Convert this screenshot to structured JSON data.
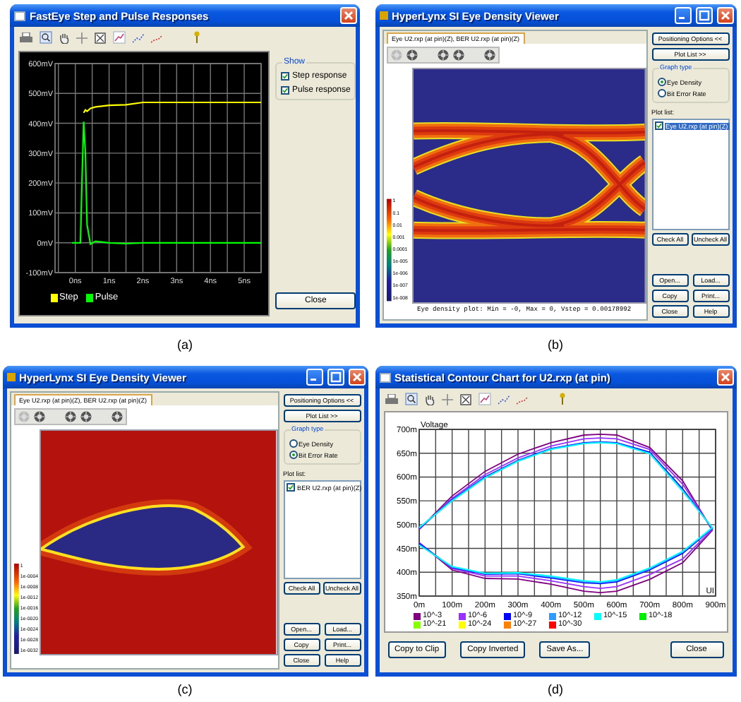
{
  "panels": [
    {
      "kind": "step_response",
      "window": {
        "title": "FastEye Step and Pulse Responses"
      },
      "chart": {
        "chart_data": {
          "type": "line",
          "x": [
            -0.1,
            0.15,
            0.2,
            0.25,
            0.3,
            0.35,
            0.45,
            0.6,
            1,
            1.5,
            2,
            2.5,
            3,
            4,
            5.5
          ],
          "xlim": [
            -0.6,
            5.5
          ],
          "ylim": [
            -100,
            600
          ],
          "xticks": [
            {
              "value": 0,
              "label": "0ns"
            },
            {
              "value": 1,
              "label": "1ns"
            },
            {
              "value": 2,
              "label": "2ns"
            },
            {
              "value": 3,
              "label": "3ns"
            },
            {
              "value": 4,
              "label": "4ns"
            },
            {
              "value": 5,
              "label": "5ns"
            }
          ],
          "yticks": [
            {
              "value": 600,
              "label": "600mV"
            },
            {
              "value": 500,
              "label": "500mV"
            },
            {
              "value": 400,
              "label": "400mV"
            },
            {
              "value": 300,
              "label": "300mV"
            },
            {
              "value": 200,
              "label": "200mV"
            },
            {
              "value": 100,
              "label": "100mV"
            },
            {
              "value": 0,
              "label": "0mV"
            },
            {
              "value": -100,
              "label": "-100mV"
            }
          ],
          "series": [
            {
              "name": "Step",
              "color": "#ffff00",
              "values": [
                null,
                null,
                null,
                435,
                445,
                440,
                450,
                455,
                460,
                462,
                470,
                470,
                470,
                470,
                470
              ]
            },
            {
              "name": "Pulse",
              "color": "#00ff00",
              "values": [
                0,
                0,
                210,
                405,
                300,
                60,
                -5,
                5,
                0,
                -3,
                0,
                0,
                0,
                0,
                0
              ]
            }
          ],
          "grid": true
        }
      },
      "show_group": {
        "title": "Show",
        "options": [
          {
            "label": "Step response",
            "checked": true
          },
          {
            "label": "Pulse response",
            "checked": true
          }
        ]
      },
      "buttons": [
        "Close"
      ],
      "caption": "(a)"
    },
    {
      "kind": "eye_viewer",
      "window": {
        "title": "HyperLynx SI Eye Density Viewer"
      },
      "tab": {
        "label": "Eye U2.rxp (at pin)(Z), BER U2.rxp (at pin)(Z)"
      },
      "scale_labels": [
        "1",
        "0.1",
        "0.01",
        "0.001",
        "0.0001",
        "1e-005",
        "1e-006",
        "1e-007",
        "1e-008"
      ],
      "plot_caption": "Eye density plot: Min = -0, Max = 0, Vstep = 0.00178992",
      "side": {
        "top_buttons": [
          "Positioning Options <<",
          "Plot List >>"
        ],
        "graph_type": {
          "title": "Graph type",
          "options": [
            {
              "label": "Eye Density",
              "selected": true
            },
            {
              "label": "Bit Error Rate",
              "selected": false
            }
          ]
        },
        "plot_list": {
          "title": "Plot list:",
          "items": [
            {
              "label": "Eye U2.rxp (at pin)(Z)",
              "checked": true,
              "selected": true
            }
          ]
        },
        "list_buttons": [
          "Check All",
          "Uncheck All"
        ],
        "buttons": [
          "Open...",
          "Load...",
          "Copy",
          "Print...",
          "Close",
          "Help"
        ]
      },
      "caption": "(b)"
    },
    {
      "kind": "eye_viewer",
      "window": {
        "title": "HyperLynx SI Eye Density Viewer"
      },
      "tab": {
        "label": "Eye U2.rxp (at pin)(Z), BER U2.rxp (at pin)(Z)"
      },
      "scale_labels": [
        "1",
        "1e-0004",
        "1e-0008",
        "1e-0012",
        "1e-0016",
        "1e-0020",
        "1e-0024",
        "1e-0028",
        "1e-0032"
      ],
      "side": {
        "top_buttons": [
          "Positioning Options <<",
          "Plot List >>"
        ],
        "graph_type": {
          "title": "Graph type",
          "options": [
            {
              "label": "Eye Density",
              "selected": false
            },
            {
              "label": "Bit Error Rate",
              "selected": true
            }
          ]
        },
        "plot_list": {
          "title": "Plot list:",
          "items": [
            {
              "label": "BER U2.rxp (at pin)(Z)",
              "checked": true,
              "selected": false
            }
          ]
        },
        "list_buttons": [
          "Check All",
          "Uncheck All"
        ],
        "buttons": [
          "Open...",
          "Load...",
          "Copy",
          "Print...",
          "Close",
          "Help"
        ]
      },
      "caption": "(c)"
    },
    {
      "kind": "contour_chart",
      "window": {
        "title": "Statistical Contour Chart for U2.rxp (at pin)"
      },
      "chart": {
        "chart_data": {
          "type": "line",
          "xlabel": "UI",
          "ylabel": "Voltage",
          "x": [
            0,
            100,
            200,
            300,
            400,
            500,
            550,
            600,
            700,
            800,
            890,
            800,
            700,
            600,
            550,
            500,
            400,
            300,
            200,
            100,
            0
          ],
          "xlim": [
            0,
            900
          ],
          "ylim": [
            350,
            700
          ],
          "xticks": [
            {
              "value": 0,
              "label": "0m"
            },
            {
              "value": 100,
              "label": "100m"
            },
            {
              "value": 200,
              "label": "200m"
            },
            {
              "value": 300,
              "label": "300m"
            },
            {
              "value": 400,
              "label": "400m"
            },
            {
              "value": 500,
              "label": "500m"
            },
            {
              "value": 600,
              "label": "600m"
            },
            {
              "value": 700,
              "label": "700m"
            },
            {
              "value": 800,
              "label": "800m"
            },
            {
              "value": 900,
              "label": "900m"
            }
          ],
          "yticks": [
            {
              "value": 700,
              "label": "700m"
            },
            {
              "value": 650,
              "label": "650m"
            },
            {
              "value": 600,
              "label": "600m"
            },
            {
              "value": 550,
              "label": "550m"
            },
            {
              "value": 500,
              "label": "500m"
            },
            {
              "value": 450,
              "label": "450m"
            },
            {
              "value": 400,
              "label": "400m"
            },
            {
              "value": 350,
              "label": "350m"
            }
          ],
          "series": [
            {
              "color": "#800080",
              "values": [
                490,
                560,
                612,
                648,
                672,
                688,
                690,
                688,
                662,
                592,
                488,
                420,
                385,
                360,
                357,
                360,
                375,
                386,
                387,
                405,
                462
              ]
            },
            {
              "color": "#9b30ff",
              "values": [
                490,
                555,
                605,
                640,
                665,
                680,
                682,
                680,
                658,
                585,
                490,
                428,
                395,
                370,
                366,
                370,
                382,
                392,
                392,
                408,
                462
              ]
            },
            {
              "color": "#0000ff",
              "values": [
                492,
                552,
                600,
                635,
                660,
                672,
                674,
                672,
                652,
                575,
                492,
                440,
                405,
                380,
                376,
                378,
                388,
                397,
                396,
                410,
                460
              ]
            },
            {
              "color": "#3399ff",
              "values": [
                493,
                551,
                599,
                634,
                659,
                671,
                673,
                671,
                650,
                572,
                493,
                442,
                407,
                382,
                378,
                380,
                390,
                398,
                397,
                411,
                458
              ]
            },
            {
              "color": "#00ffff",
              "values": [
                494,
                550,
                598,
                633,
                658,
                670,
                672,
                670,
                649,
                570,
                494,
                444,
                409,
                384,
                380,
                382,
                392,
                399,
                398,
                412,
                457
              ]
            }
          ],
          "grid": true
        }
      },
      "legend": [
        {
          "label": "10^-3",
          "color": "#800080"
        },
        {
          "label": "10^-6",
          "color": "#9b30ff"
        },
        {
          "label": "10^-9",
          "color": "#0000ff"
        },
        {
          "label": "10^-12",
          "color": "#3399ff"
        },
        {
          "label": "10^-15",
          "color": "#00ffff"
        },
        {
          "label": "10^-18",
          "color": "#00ee00"
        },
        {
          "label": "10^-21",
          "color": "#88ff00"
        },
        {
          "label": "10^-24",
          "color": "#ffff00"
        },
        {
          "label": "10^-27",
          "color": "#ff8000"
        },
        {
          "label": "10^-30",
          "color": "#ff0000"
        }
      ],
      "buttons": [
        "Copy to Clip",
        "Copy Inverted",
        "Save As...",
        "Close"
      ],
      "caption": "(d)"
    }
  ]
}
